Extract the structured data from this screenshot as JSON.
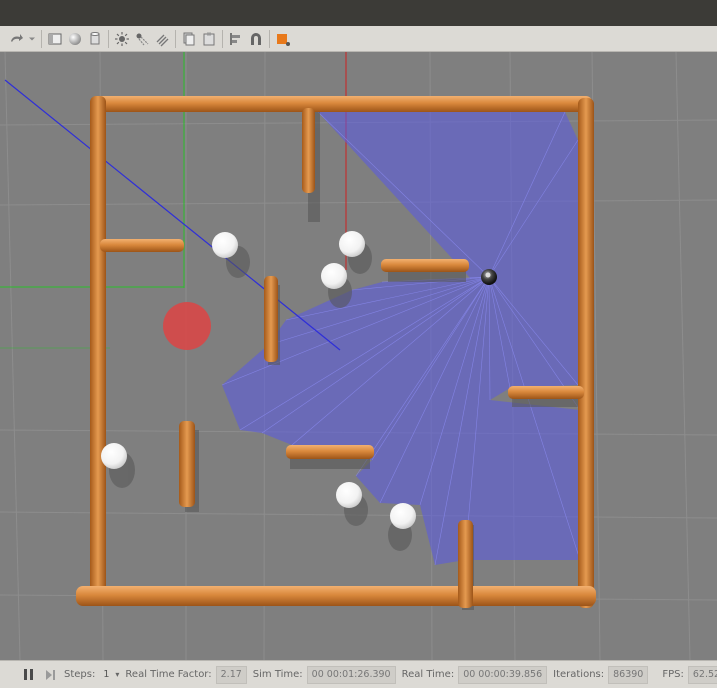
{
  "toolbar": {
    "icons": [
      "redo-arrow-icon",
      "dropdown-arrow-icon",
      "box-shape-icon",
      "sphere-shape-icon",
      "cylinder-shape-icon",
      "point-light-icon",
      "spot-light-icon",
      "directional-light-icon",
      "copy-icon",
      "paste-icon",
      "align-icon",
      "snap-magnet-icon",
      "orange-view-angle-icon"
    ],
    "accent": "#e8791b"
  },
  "scene": {
    "wall_color": "#d9883c",
    "ground_color": "#7f7f7f",
    "laser_color": "#5a5ae6",
    "goal_color": "#dd4444",
    "robot_color": "#222222"
  },
  "statusbar": {
    "steps_label": "Steps:",
    "steps_value": "1",
    "rtf_label": "Real Time Factor:",
    "rtf_value": "2.17",
    "sim_time_label": "Sim Time:",
    "sim_time_value": "00 00:01:26.390",
    "real_time_label": "Real Time:",
    "real_time_value": "00 00:00:39.856",
    "iterations_label": "Iterations:",
    "iterations_value": "86390",
    "fps_label": "FPS:",
    "fps_value": "62.52"
  }
}
